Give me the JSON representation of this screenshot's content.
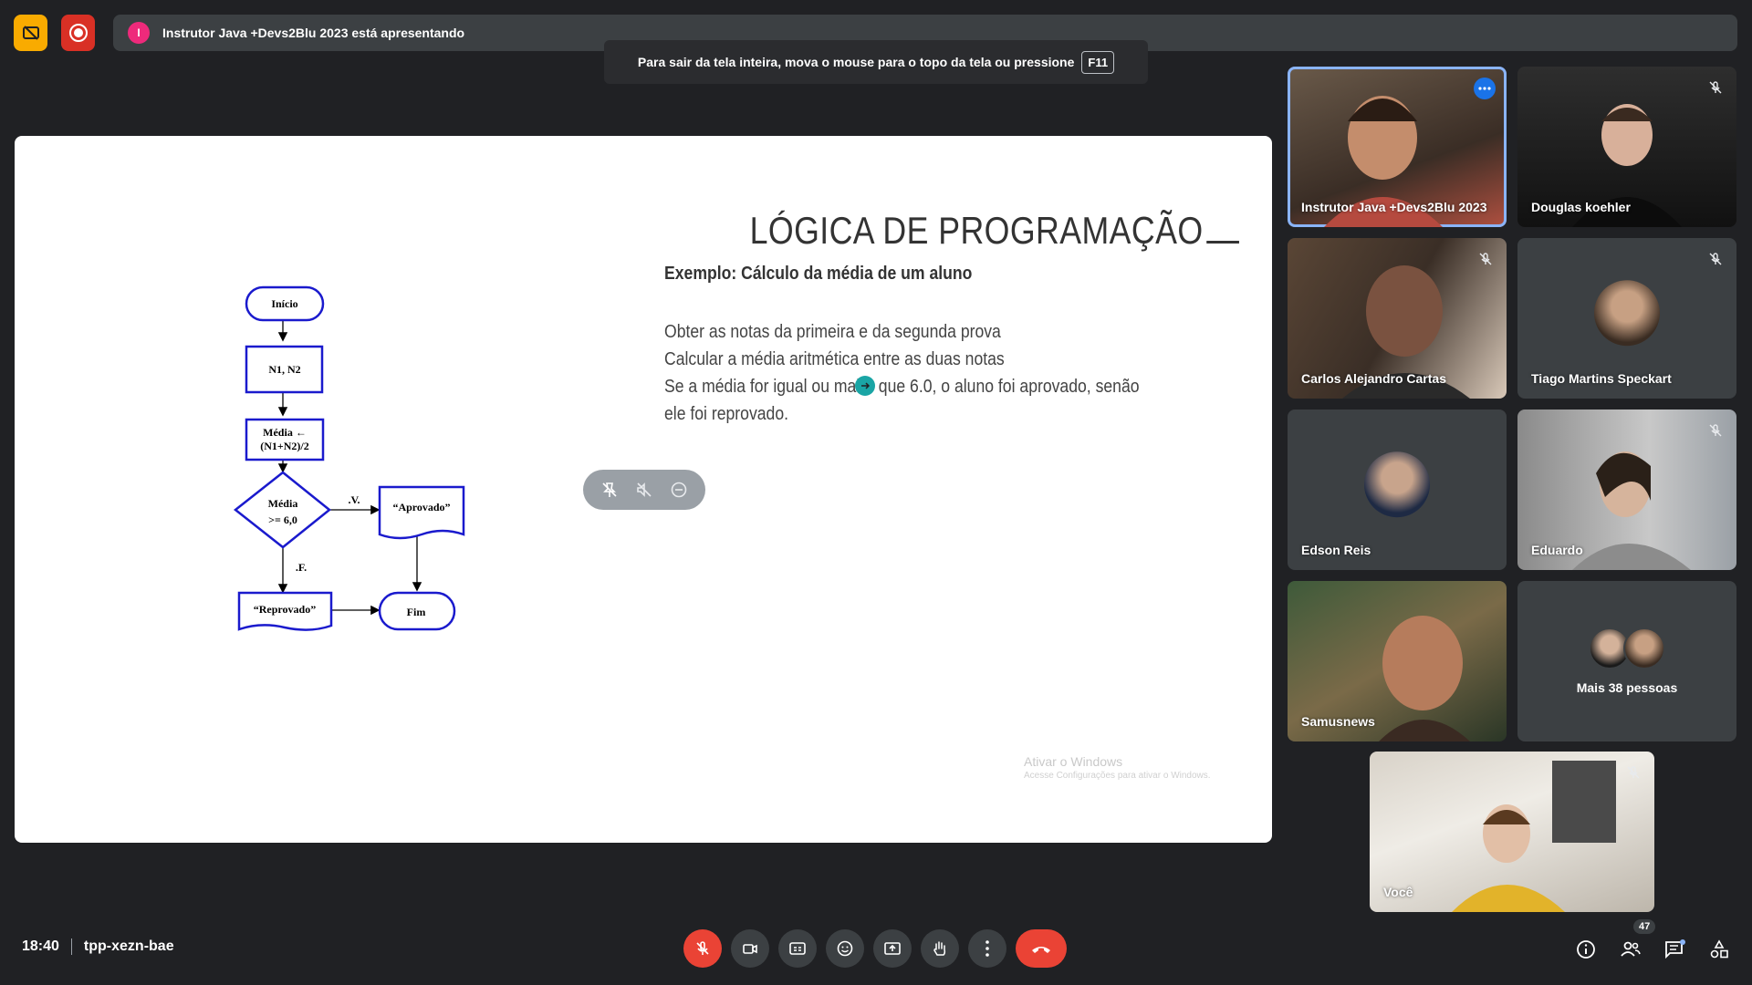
{
  "presentation_banner": {
    "presenter_initial": "I",
    "text": "Instrutor Java +Devs2Blu 2023 está apresentando"
  },
  "fullscreen_toast": {
    "text": "Para sair da tela inteira, mova o mouse para o topo da tela ou pressione",
    "key": "F11"
  },
  "slide": {
    "title": "LÓGICA DE PROGRAMAÇÃO",
    "subtitle": "Exemplo: Cálculo da média de um aluno",
    "lines": [
      "Obter as notas da primeira e da segunda prova",
      "Calcular a média aritmética entre as duas notas",
      "Se a média for igual ou maior que 6.0, o aluno foi aprovado, senão",
      "ele foi reprovado."
    ],
    "flowchart": {
      "start": "Início",
      "input": "N1, N2",
      "assign_line1": "Média ←",
      "assign_line2": "(N1+N2)/2",
      "decision_line1": "Média",
      "decision_line2": ">= 6,0",
      "true_label": ".V.",
      "false_label": ".F.",
      "approved": "“Aprovado”",
      "failed": "“Reprovado”",
      "end": "Fim"
    },
    "watermark_title": "Ativar o Windows",
    "watermark_subtitle": "Acesse Configurações para ativar o Windows."
  },
  "participants": [
    {
      "name": "Instrutor Java +Devs2Blu 2023",
      "muted": false
    },
    {
      "name": "Douglas koehler",
      "muted": true
    },
    {
      "name": "Carlos Alejandro Cartas",
      "muted": true
    },
    {
      "name": "Tiago Martins Speckart",
      "muted": true
    },
    {
      "name": "Edson Reis",
      "muted": false
    },
    {
      "name": "Eduardo",
      "muted": true
    },
    {
      "name": "Samusnews",
      "muted": false
    },
    {
      "name": "Você",
      "muted": true
    }
  ],
  "more_people": "Mais 38 pessoas",
  "bottom": {
    "time": "18:40",
    "meeting_code": "tpp-xezn-bae",
    "participant_count": "47"
  },
  "colors": {
    "background": "#202124",
    "tile": "#3c4043",
    "danger": "#ea4335",
    "accent": "#8ab4f8",
    "flowchart_blue": "#1a1acd"
  }
}
